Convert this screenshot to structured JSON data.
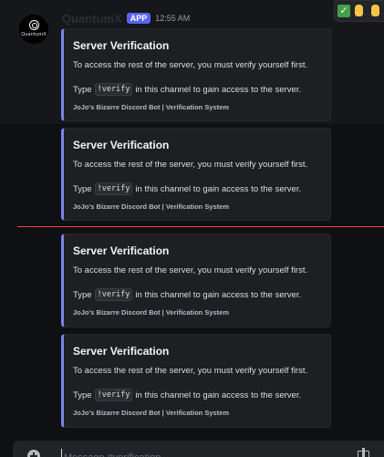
{
  "message": {
    "avatar_text": "QuantumX",
    "username": "QuantumX",
    "badge": "APP",
    "timestamp": "12:55 AM"
  },
  "reactions": [
    {
      "icon": "check-mark-emoji"
    },
    {
      "icon": "raised-finger-emoji"
    },
    {
      "icon": "raised-finger-emoji"
    }
  ],
  "embeds": [
    {
      "title": "Server Verification",
      "description_line1": "To access the rest of the server, you must verify yourself first.",
      "description_pre": "Type",
      "command": "!verify",
      "description_post": "in this channel to gain access to the server.",
      "footer": "JoJo's Bizarre Discord Bot | Verification System"
    },
    {
      "title": "Server Verification",
      "description_line1": "To access the rest of the server, you must verify yourself first.",
      "description_pre": "Type",
      "command": "!verify",
      "description_post": "in this channel to gain access to the server.",
      "footer": "JoJo's Bizarre Discord Bot | Verification System"
    },
    {
      "title": "Server Verification",
      "description_line1": "To access the rest of the server, you must verify yourself first.",
      "description_pre": "Type",
      "command": "!verify",
      "description_post": "in this channel to gain access to the server.",
      "footer": "JoJo's Bizarre Discord Bot | Verification System"
    },
    {
      "title": "Server Verification",
      "description_line1": "To access the rest of the server, you must verify yourself first.",
      "description_pre": "Type",
      "command": "!verify",
      "description_post": "in this channel to gain access to the server.",
      "footer": "JoJo's Bizarre Discord Bot | Verification System"
    }
  ],
  "input": {
    "placeholder": "Message #verification"
  },
  "colors": {
    "accent": "#5865f2",
    "embed_border": "#7b83e8",
    "new_messages_line": "#f23f43",
    "check_green": "#43a047"
  }
}
